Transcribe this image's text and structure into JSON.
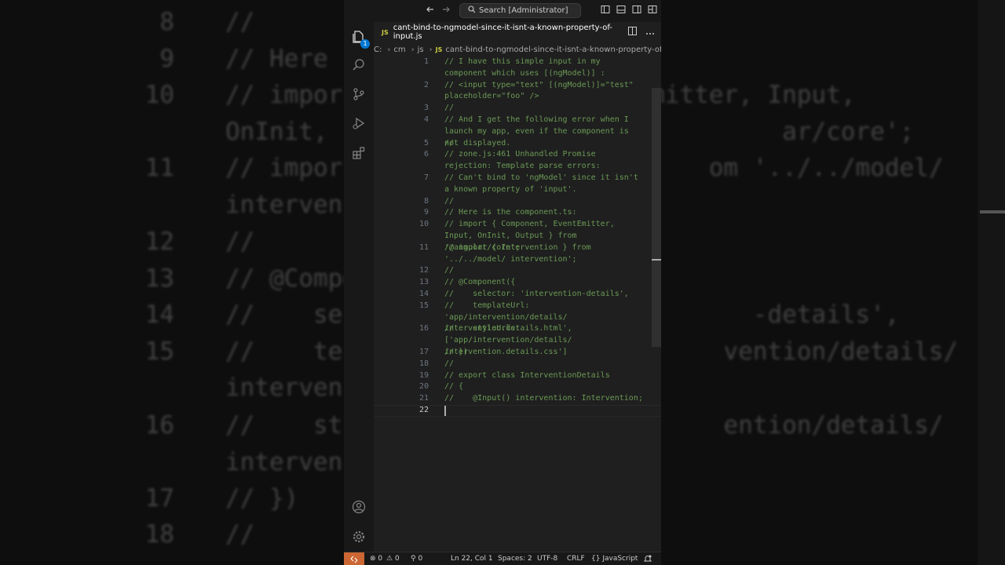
{
  "background": {
    "lines": [
      {
        "num": "8",
        "text": "//"
      },
      {
        "num": "9",
        "text": "// Here"
      },
      {
        "num": "10",
        "text": "// impor                     mitter, Input,"
      },
      {
        "num": "",
        "text": "OnInit,                               ar/core';"
      },
      {
        "num": "11",
        "text": "// impor                         om '../../model/"
      },
      {
        "num": "",
        "text": "interven"
      },
      {
        "num": "12",
        "text": "//"
      },
      {
        "num": "13",
        "text": "// @Compo"
      },
      {
        "num": "14",
        "text": "//    se                            -details',"
      },
      {
        "num": "15",
        "text": "//    te                          vention/details/"
      },
      {
        "num": "",
        "text": "interven"
      },
      {
        "num": "16",
        "text": "//    st                          ention/details/"
      },
      {
        "num": "",
        "text": "interven"
      },
      {
        "num": "17",
        "text": "// })"
      },
      {
        "num": "18",
        "text": "//"
      }
    ]
  },
  "titlebar": {
    "search_label": "Search [Administrator]"
  },
  "activitybar": {
    "explorer_badge": "1"
  },
  "tab": {
    "badge": "JS",
    "filename": "cant-bind-to-ngmodel-since-it-isnt-a-known-property-of-input.js"
  },
  "breadcrumb": {
    "items": [
      "C:",
      "cm",
      "js"
    ],
    "file_badge": "JS",
    "file": "cant-bind-to-ngmodel-since-it-isnt-a-known-property-of...",
    "more": "..."
  },
  "code_lines": [
    {
      "num": "1",
      "text": "// I have this simple input in my component which uses [(ngModel)] :"
    },
    {
      "num": "2",
      "text": "// <input type=\"text\" [(ngModel)]=\"test\" placeholder=\"foo\" />"
    },
    {
      "num": "3",
      "text": "//"
    },
    {
      "num": "4",
      "text": "// And I get the following error when I launch my app, even if the component is not displayed."
    },
    {
      "num": "5",
      "text": "//"
    },
    {
      "num": "6",
      "text": "// zone.js:461 Unhandled Promise rejection: Template parse errors:"
    },
    {
      "num": "7",
      "text": "// Can't bind to 'ngModel' since it isn't a known property of 'input'."
    },
    {
      "num": "8",
      "text": "//"
    },
    {
      "num": "9",
      "text": "// Here is the component.ts:"
    },
    {
      "num": "10",
      "text": "// import { Component, EventEmitter, Input, OnInit, Output } from '@angular/core';"
    },
    {
      "num": "11",
      "text": "// import { Intervention } from '../../model/ intervention';"
    },
    {
      "num": "12",
      "text": "//"
    },
    {
      "num": "13",
      "text": "// @Component({"
    },
    {
      "num": "14",
      "text": "//    selector: 'intervention-details',"
    },
    {
      "num": "15",
      "text": "//    templateUrl: 'app/intervention/details/ intervention.details.html',"
    },
    {
      "num": "16",
      "text": "//    styleUrls: ['app/intervention/details/ intervention.details.css']"
    },
    {
      "num": "17",
      "text": "// })"
    },
    {
      "num": "18",
      "text": "//"
    },
    {
      "num": "19",
      "text": "// export class InterventionDetails"
    },
    {
      "num": "20",
      "text": "// {"
    },
    {
      "num": "21",
      "text": "//    @Input() intervention: Intervention;"
    },
    {
      "num": "22",
      "text": ""
    }
  ],
  "statusbar": {
    "errors": "0",
    "warnings": "0",
    "ports": "0",
    "position": "Ln 22, Col 1",
    "spaces": "Spaces: 2",
    "encoding": "UTF-8",
    "eol": "CRLF",
    "language": "JavaScript"
  },
  "colors": {
    "comment": "#6a9955",
    "line_number": "#6e7681",
    "editor_bg": "#1f1f1f",
    "remote_accent": "#cc6633"
  }
}
